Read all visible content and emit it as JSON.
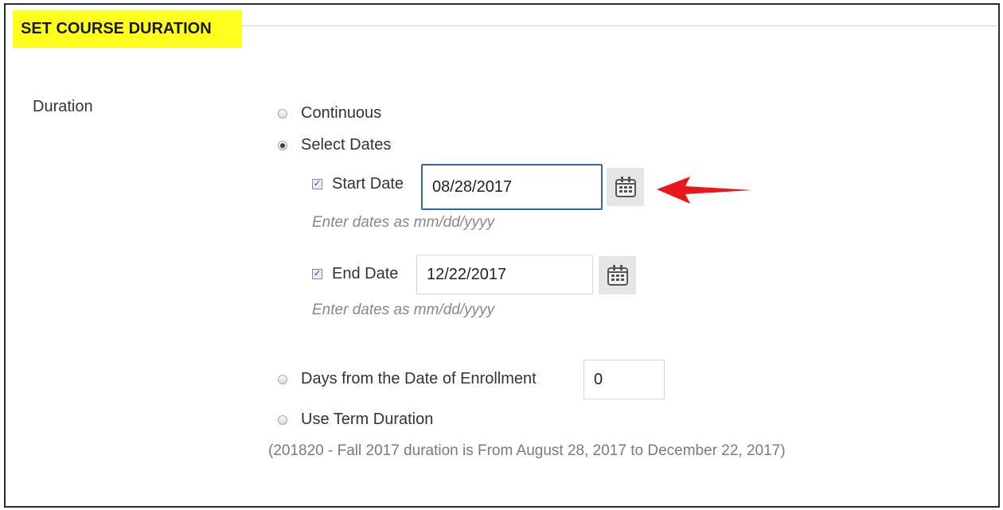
{
  "section": {
    "title": "SET COURSE DURATION"
  },
  "duration": {
    "label": "Duration",
    "options": {
      "continuous": "Continuous",
      "select_dates": "Select Dates",
      "days_from_enrollment": "Days from the Date of Enrollment",
      "term_duration": "Use Term Duration"
    },
    "selected": "select_dates",
    "start_date": {
      "label": "Start Date",
      "value": "08/28/2017",
      "checked": true
    },
    "end_date": {
      "label": "End Date",
      "value": "12/22/2017",
      "checked": true
    },
    "date_hint": "Enter dates as mm/dd/yyyy",
    "days_value": "0",
    "term_note": "(201820 - Fall 2017 duration is From August 28, 2017 to December 22, 2017)"
  },
  "colors": {
    "highlight": "#ffff1e",
    "focus_border": "#2c6aa5",
    "arrow": "#e8181a"
  },
  "icons": {
    "calendar": "calendar-icon",
    "arrow": "red-arrow-icon"
  }
}
